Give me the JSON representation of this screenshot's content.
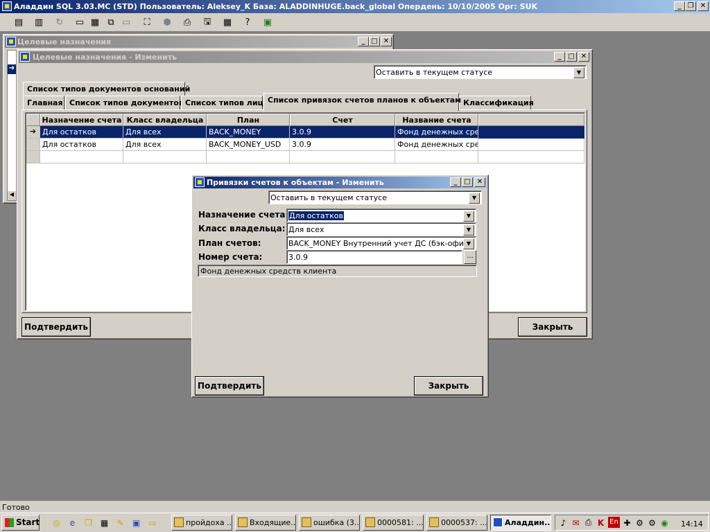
{
  "app": {
    "title": "Аладдин SQL 3.03.MC (STD)  Пользователь: Aleksey_K База: ALADDINHUGE.back_global Опердень: 10/10/2005 Орг: SUK",
    "status_text": "Готово"
  },
  "toolbar": {
    "icons": [
      "ledger-icon",
      "book-icon",
      "refresh-icon",
      "window-icon",
      "tile-icon",
      "cascade-icon",
      "blank-window-icon",
      "binoculars-icon",
      "stop-icon",
      "print-icon",
      "save-icon",
      "calendar-icon",
      "help-icon",
      "exit-icon"
    ]
  },
  "win_bg": {
    "title": "Целевые назначения"
  },
  "win_edit": {
    "title": "Целевые назначения - Изменить",
    "status_combo": "Оставить в текущем статусе",
    "tabs_row1": [
      "Список типов документов оснований"
    ],
    "tabs_row2": [
      "Главная",
      "Список типов документов",
      "Список типов лиц",
      "Список привязок счетов планов к объектам",
      "Классификация"
    ],
    "grid": {
      "headers": [
        "Назначение счета",
        "Класс владельца",
        "План",
        "Счет",
        "Название счета"
      ],
      "rows": [
        [
          "Для остатков",
          "Для всех",
          "BACK_MONEY",
          "3.0.9",
          "Фонд денежных средс"
        ],
        [
          "Для остатков",
          "Для всех",
          "BACK_MONEY_USD",
          "3.0.9",
          "Фонд денежных средс"
        ]
      ]
    },
    "confirm_label": "Подтвердить",
    "close_label": "Закрыть"
  },
  "dialog": {
    "title": "Привязки счетов к объектам - Изменить",
    "status_combo": "Оставить в текущем статусе",
    "fields": {
      "purpose_label": "Назначение счета:",
      "purpose_value": "Для остатков",
      "owner_label": "Класс владельца:",
      "owner_value": "Для всех",
      "plan_label": "План счетов:",
      "plan_value": "BACK_MONEY Внутренний учет ДС (бэк-офис)",
      "account_label": "Номер счета:",
      "account_value": "3.0.9",
      "browse_label": "...",
      "account_name": "Фонд денежных средств клиента"
    },
    "confirm_label": "Подтвердить",
    "close_label": "Закрыть"
  },
  "taskbar": {
    "start_label": "Start",
    "tasks": [
      "пройдоха ...",
      "Входящие...",
      "ошибка (3...",
      "0000581: ...",
      "0000537: ...",
      "Аладдин..."
    ],
    "lang": "En",
    "clock": "14:14"
  }
}
